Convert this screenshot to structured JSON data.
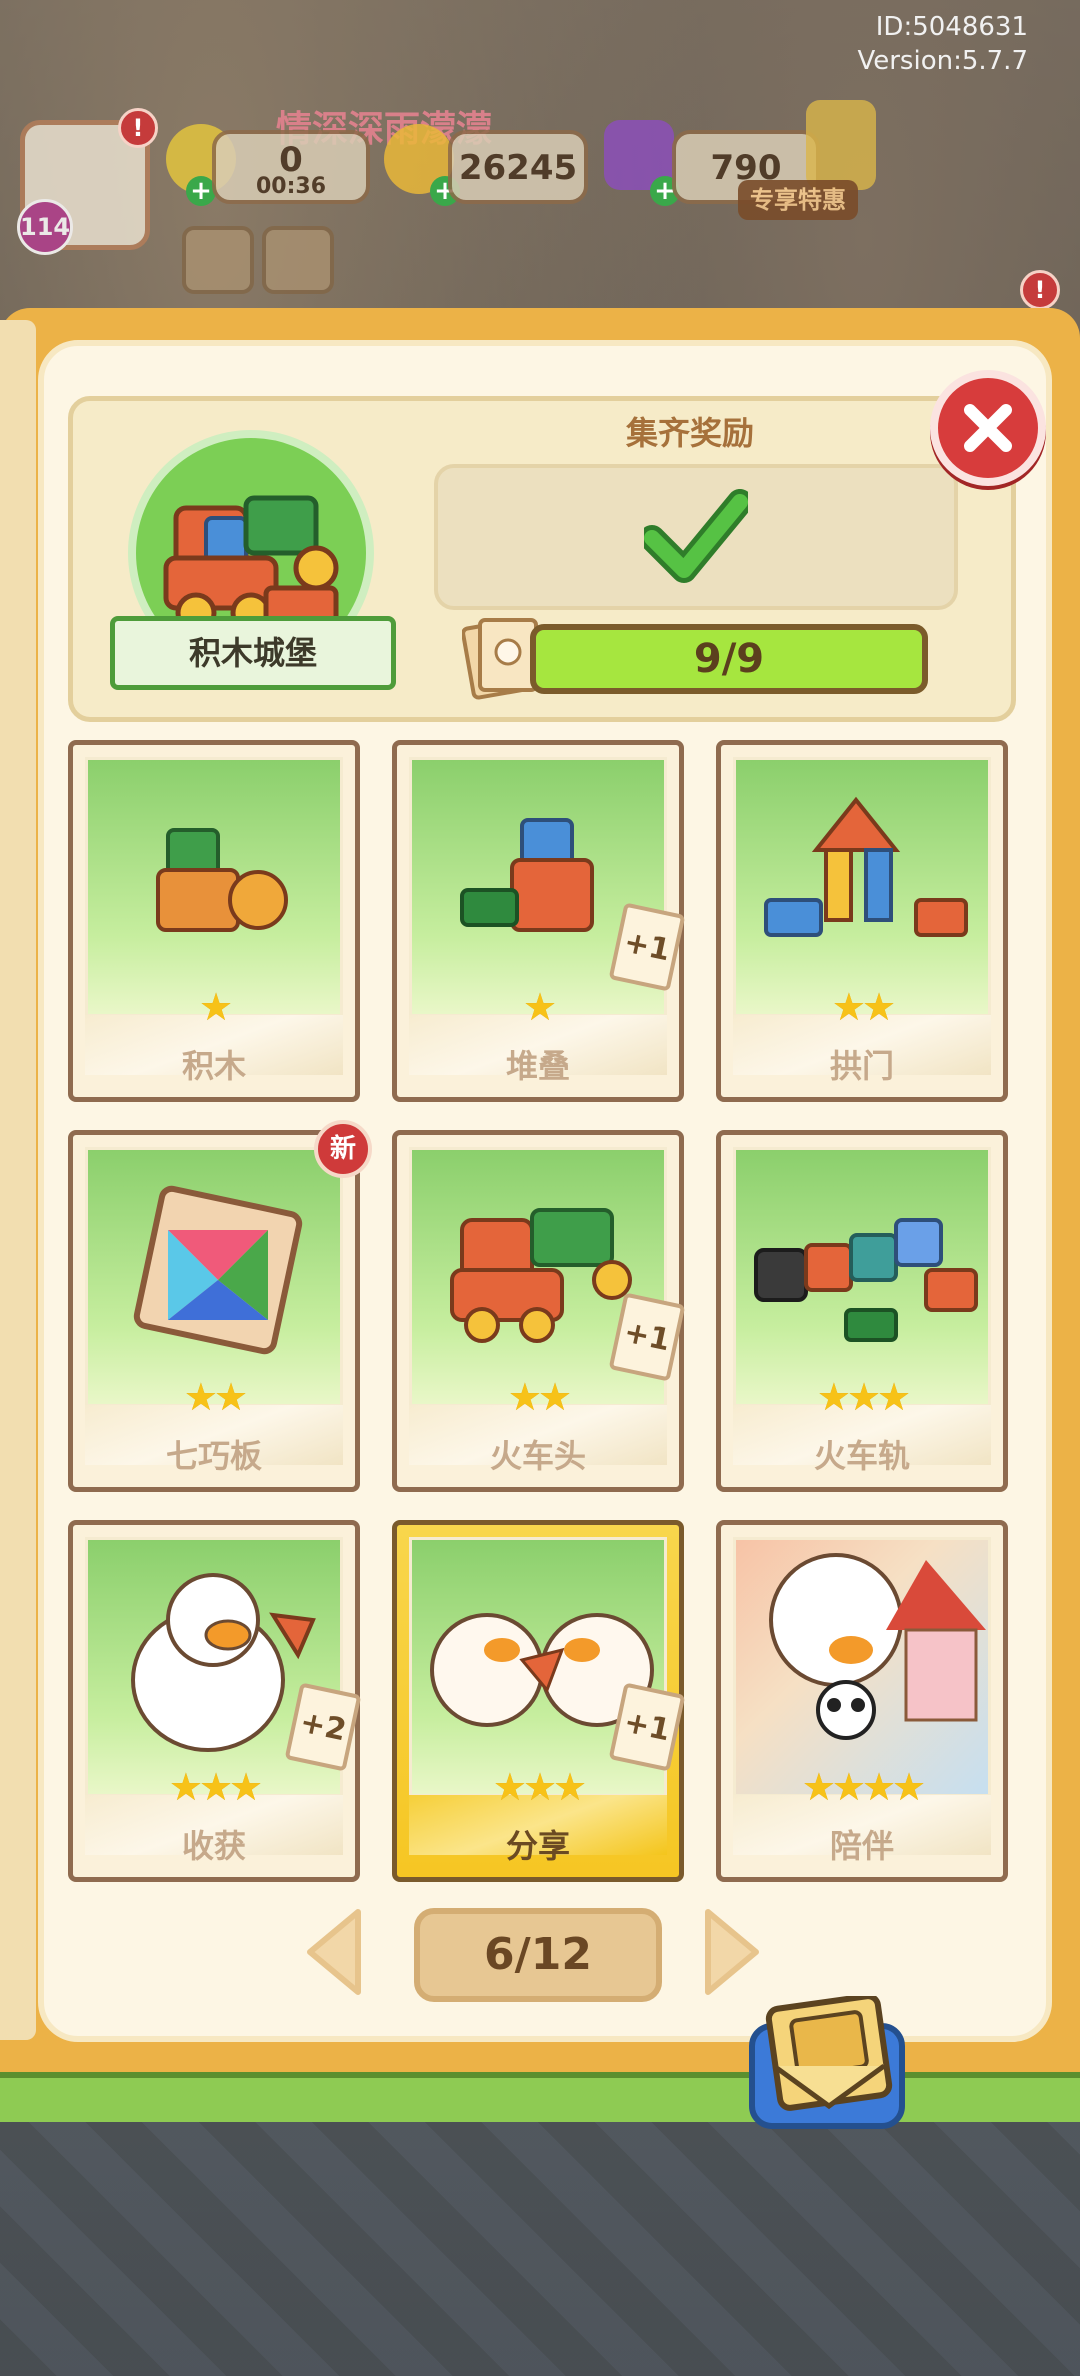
{
  "hud": {
    "id_text": "ID:5048631",
    "version_text": "Version:5.7.7",
    "player_name": "情深深雨濛濛",
    "level": "114",
    "energy_value": "0",
    "energy_timer": "00:36",
    "coins_value": "26245",
    "gems_value": "790",
    "deal_label": "专享特惠",
    "alert_mark": "!"
  },
  "album": {
    "set_name": "积木城堡",
    "reward_title": "集齐奖励",
    "progress_text": "9/9",
    "page_text": "6/12",
    "close_icon": "close-icon",
    "new_label": "新",
    "cards": [
      {
        "name": "积木",
        "stars": "★",
        "extra": ""
      },
      {
        "name": "堆叠",
        "stars": "★",
        "extra": "+1"
      },
      {
        "name": "拱门",
        "stars": "★★",
        "extra": ""
      },
      {
        "name": "七巧板",
        "stars": "★★",
        "extra": ""
      },
      {
        "name": "火车头",
        "stars": "★★",
        "extra": "+1"
      },
      {
        "name": "火车轨",
        "stars": "★★★",
        "extra": ""
      },
      {
        "name": "收获",
        "stars": "★★★",
        "extra": "+2"
      },
      {
        "name": "分享",
        "stars": "★★★",
        "extra": "+1"
      },
      {
        "name": "陪伴",
        "stars": "★★★★",
        "extra": ""
      }
    ]
  },
  "colors": {
    "frame": "#ecb247",
    "panel": "#fdf6e4",
    "progress": "#a6e63f",
    "close": "#d73c3c",
    "card_gold": "#f6c623"
  }
}
